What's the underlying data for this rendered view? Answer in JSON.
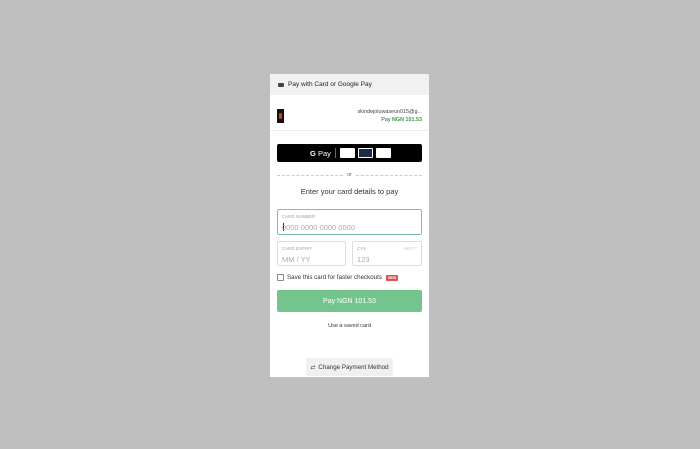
{
  "header": {
    "title": "Pay with Card or Google Pay",
    "icon": "card-icon"
  },
  "merchant": {
    "email": "skindejoluwaseun015@g...",
    "pay_prefix": "Pay",
    "amount": "NGN 101.53"
  },
  "gpay": {
    "label": "Pay",
    "g": "G"
  },
  "divider": {
    "text": "or"
  },
  "form": {
    "heading": "Enter your card details to pay",
    "card_number": {
      "label": "CARD NUMBER",
      "placeholder": "0000 0000 0000 0000"
    },
    "expiry": {
      "label": "CARD EXPIRY",
      "placeholder": "MM / YY"
    },
    "cvv": {
      "label": "CVV",
      "placeholder": "123",
      "help": "HELP?"
    },
    "save_label": "Save this card for faster checkouts",
    "save_badge": "NEW"
  },
  "pay_button": {
    "label": "Pay NGN 101.53"
  },
  "saved_card_link": "Use a saved card",
  "change_method": {
    "icon": "⇄",
    "label": "Change Payment Method"
  },
  "colors": {
    "accent_green": "#73c58d",
    "amount_green": "#2a9d4a",
    "badge_red": "#d9534f"
  }
}
